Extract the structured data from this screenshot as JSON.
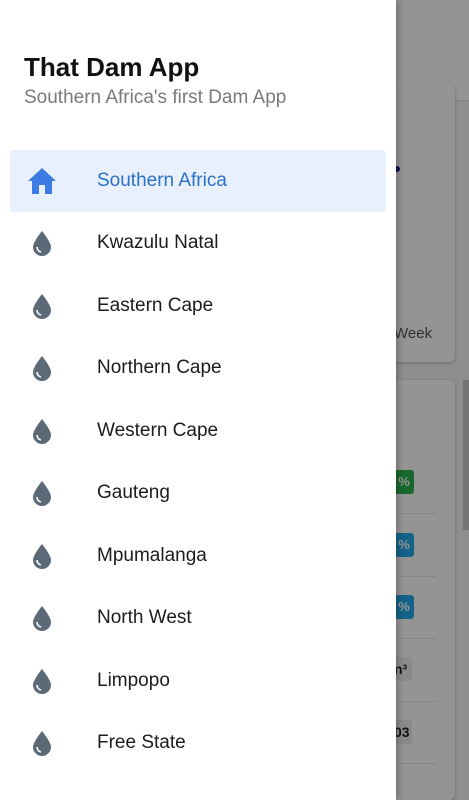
{
  "drawer": {
    "title": "That Dam App",
    "subtitle": "Southern Africa's first Dam App",
    "items": [
      {
        "label": "Southern Africa",
        "icon": "home-icon",
        "active": true
      },
      {
        "label": "Kwazulu Natal",
        "icon": "water-drop-icon",
        "active": false
      },
      {
        "label": "Eastern Cape",
        "icon": "water-drop-icon",
        "active": false
      },
      {
        "label": "Northern Cape",
        "icon": "water-drop-icon",
        "active": false
      },
      {
        "label": "Western Cape",
        "icon": "water-drop-icon",
        "active": false
      },
      {
        "label": "Gauteng",
        "icon": "water-drop-icon",
        "active": false
      },
      {
        "label": "Mpumalanga",
        "icon": "water-drop-icon",
        "active": false
      },
      {
        "label": "North West",
        "icon": "water-drop-icon",
        "active": false
      },
      {
        "label": "Limpopo",
        "icon": "water-drop-icon",
        "active": false
      },
      {
        "label": "Free State",
        "icon": "water-drop-icon",
        "active": false
      }
    ]
  },
  "background": {
    "week_label": "Week",
    "badges": [
      "%",
      "%",
      "%"
    ],
    "units": [
      "n³",
      "03"
    ]
  },
  "colors": {
    "active_text": "#2a72c8",
    "active_bg": "#e8effd",
    "home_icon": "#3b7be3",
    "drop_icon": "#5c6a78"
  }
}
